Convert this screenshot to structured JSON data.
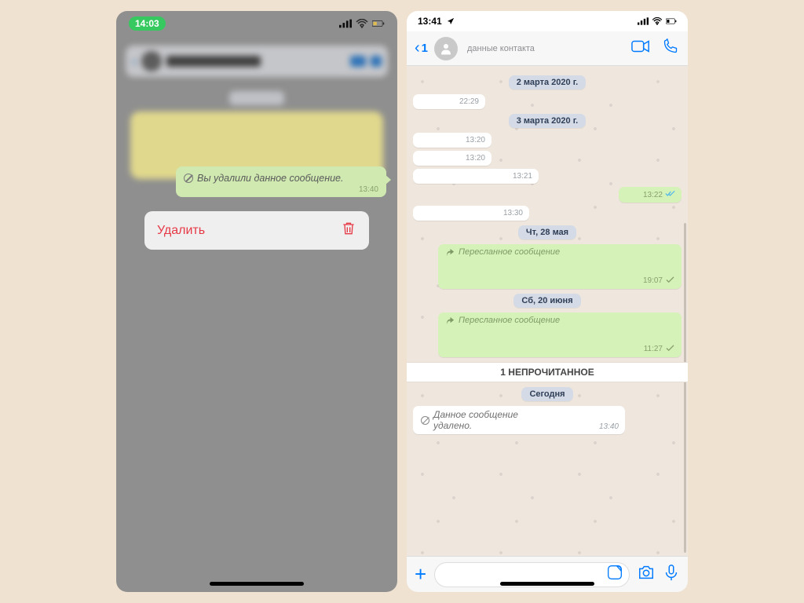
{
  "left": {
    "status_time": "14:03",
    "bubble_text": "Вы удалили данное сообщение.",
    "bubble_time": "13:40",
    "action_label": "Удалить"
  },
  "right": {
    "status_time": "13:41",
    "back_badge": "1",
    "contact_sub": "данные контакта",
    "dates": {
      "d1": "2 марта 2020 г.",
      "d2": "3 марта 2020 г.",
      "d3": "Чт, 28 мая",
      "d4": "Сб, 20 июня",
      "d5": "Сегодня"
    },
    "times": {
      "t1": "22:29",
      "t2": "13:20",
      "t3": "13:20",
      "t4": "13:21",
      "t5": "13:22",
      "t6": "13:30",
      "t7": "19:07",
      "t8": "11:27",
      "t9": "13:40"
    },
    "fwd_label": "Пересланное сообщение",
    "unread_label": "1 НЕПРОЧИТАННОЕ",
    "deleted_text": "Данное сообщение удалено."
  }
}
